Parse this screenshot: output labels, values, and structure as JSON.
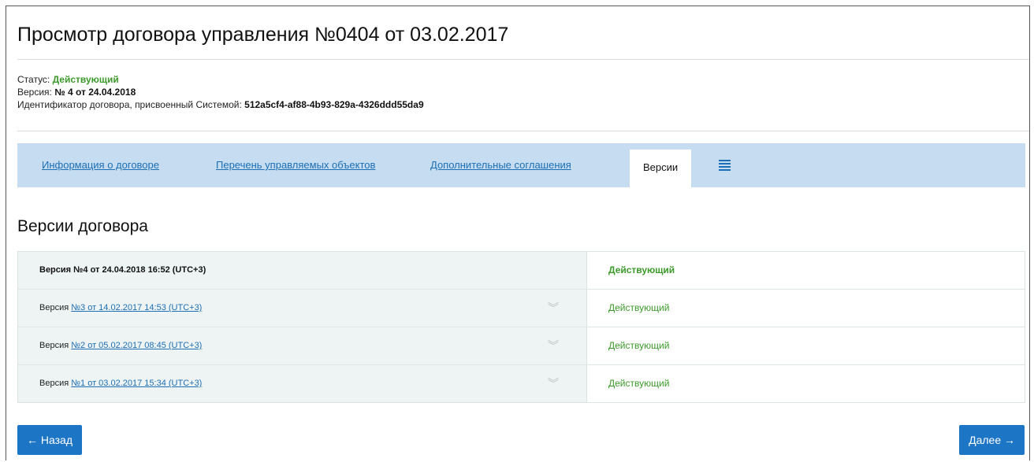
{
  "page": {
    "title": "Просмотр договора управления №0404 от 03.02.2017"
  },
  "meta": {
    "status_label": "Статус: ",
    "status_value": "Действующий",
    "version_label": "Версия: ",
    "version_value": "№ 4 от 24.04.2018",
    "id_label": "Идентификатор договора, присвоенный Системой: ",
    "id_value": "512a5cf4-af88-4b93-829a-4326ddd55da9"
  },
  "tabs": [
    {
      "label": "Информация о договоре"
    },
    {
      "label": "Перечень управляемых объектов"
    },
    {
      "label": "Дополнительные соглашения"
    },
    {
      "label": "Версии"
    }
  ],
  "menu_icon": "list-menu-icon",
  "section": {
    "title": "Версии договора"
  },
  "versions": [
    {
      "prefix": "",
      "link": "Версия №4 от 24.04.2018 16:52 (UTC+3)",
      "status": "Действующий"
    },
    {
      "prefix": "Версия ",
      "link": "№3 от 14.02.2017 14:53 (UTC+3)",
      "status": "Действующий"
    },
    {
      "prefix": "Версия ",
      "link": "№2 от 05.02.2017 08:45 (UTC+3)",
      "status": "Действующий"
    },
    {
      "prefix": "Версия ",
      "link": "№1 от 03.02.2017 15:34 (UTC+3)",
      "status": "Действующий"
    }
  ],
  "buttons": {
    "back": "← Назад",
    "next": "Далее →"
  },
  "colors": {
    "accent": "#1d75c6",
    "link": "#1c6fb5",
    "status_green": "#3b9a2a",
    "tab_bar": "#c6dcf0"
  }
}
